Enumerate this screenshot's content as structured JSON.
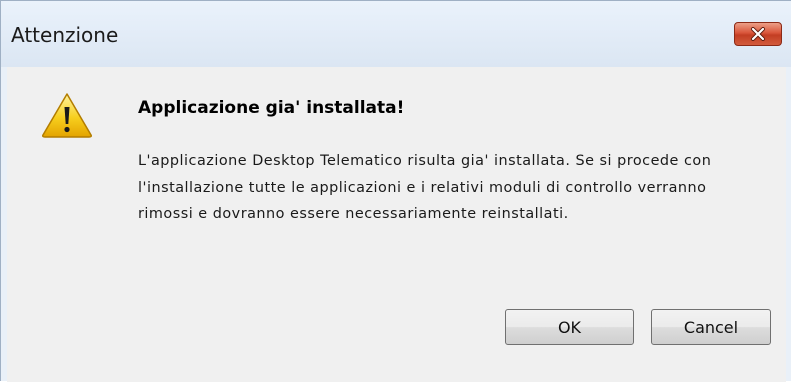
{
  "window": {
    "title": "Attenzione",
    "close_icon": "close-icon"
  },
  "dialog": {
    "icon": "warning-icon",
    "heading": "Applicazione gia' installata!",
    "message": "L'applicazione Desktop Telematico risulta gia' installata. Se si procede con l'installazione tutte le applicazioni e i relativi moduli di controllo verranno rimossi e dovranno essere necessariamente reinstallati."
  },
  "buttons": {
    "ok_label": "OK",
    "cancel_label": "Cancel"
  },
  "colors": {
    "close_button": "#d9553a",
    "warning": "#f5c400"
  }
}
